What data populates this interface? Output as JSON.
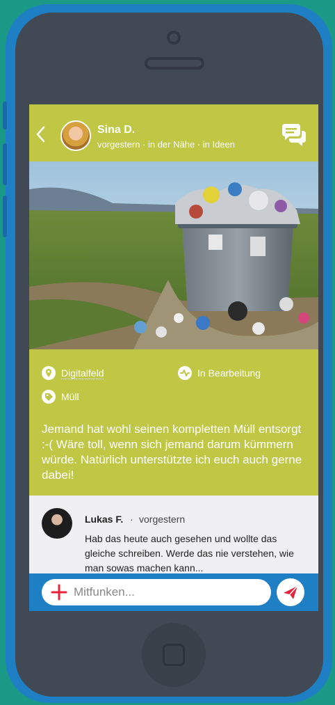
{
  "post": {
    "author": "Sina D.",
    "meta": "vorgestern · in der Nähe · in Ideen",
    "location": "Digitalfeld",
    "status": "In Bearbeitung",
    "category": "Müll",
    "description": "Jemand hat wohl seinen kompletten Müll entsorgt :-( Wäre toll, wenn sich jemand darum kümmern würde. Natürlich unterstützte ich euch auch gerne dabei!"
  },
  "comment": {
    "author": "Lukas F.",
    "separator": "·",
    "time": "vorgestern",
    "text": "Hab das heute auch gesehen und wollte das gleiche schreiben. Werde das nie verstehen, wie man sowas machen kann..."
  },
  "composer": {
    "placeholder": "Mitfunken..."
  },
  "icons": {
    "back": "chevron-left-icon",
    "chat": "chat-bubbles-icon",
    "location": "map-pin-icon",
    "status": "activity-icon",
    "category": "tag-icon",
    "add": "plus-icon",
    "send": "paper-plane-icon"
  },
  "colors": {
    "accent": "#bfc745",
    "bar": "#1f7fc4",
    "send": "#e4243a"
  }
}
